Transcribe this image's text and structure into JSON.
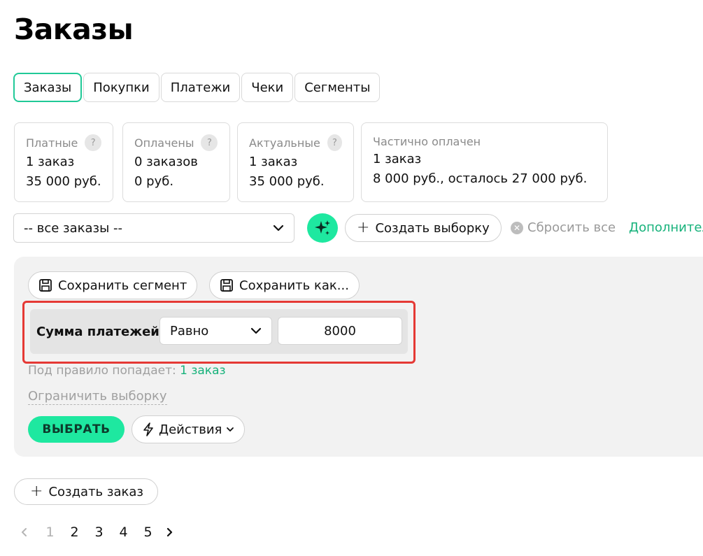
{
  "page": {
    "title": "Заказы"
  },
  "tabs": [
    {
      "label": "Заказы",
      "active": true
    },
    {
      "label": "Покупки",
      "active": false
    },
    {
      "label": "Платежи",
      "active": false
    },
    {
      "label": "Чеки",
      "active": false
    },
    {
      "label": "Сегменты",
      "active": false
    }
  ],
  "stats": [
    {
      "label": "Платные",
      "count": "1 заказ",
      "amount": "35 000 руб.",
      "help": "?"
    },
    {
      "label": "Оплачены",
      "count": "0 заказов",
      "amount": "0 руб.",
      "help": "?"
    },
    {
      "label": "Актуальные",
      "count": "1 заказ",
      "amount": "35 000 руб.",
      "help": "?"
    },
    {
      "label": "Частично оплачен",
      "count": "1 заказ",
      "amount": "8 000 руб., осталось 27 000 руб."
    }
  ],
  "filter": {
    "selected": "-- все заказы --",
    "create_selection": "Создать выборку",
    "reset_all": "Сбросить все",
    "more": "Дополнительно"
  },
  "segment": {
    "save_segment": "Сохранить сегмент",
    "save_as": "Сохранить как...",
    "rule": {
      "field": "Сумма платежей",
      "operator": "Равно",
      "value": "8000"
    },
    "match_prefix": "Под правило попадает:",
    "match_count": "1 заказ",
    "limit_selection": "Ограничить выборку",
    "select_button": "ВЫБРАТЬ",
    "actions_button": "Действия"
  },
  "create_order": "Создать заказ",
  "pagination": {
    "pages": [
      "1",
      "2",
      "3",
      "4",
      "5"
    ],
    "current": "1"
  },
  "colors": {
    "accent": "#1ee8a0",
    "link": "#17b27b",
    "highlight": "#e53935"
  }
}
